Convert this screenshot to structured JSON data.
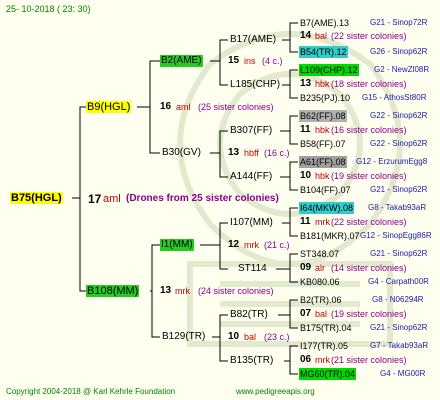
{
  "header": {
    "date": "25- 10-2018 ( 23: 30)"
  },
  "footer": {
    "copyright": "Copyright 2004-2018 @ Karl Kehrle Foundation",
    "site": "www.pedigreeapis.org"
  },
  "root": {
    "name": "B75(HGL)",
    "num": "17",
    "race": "aml",
    "note": "(Drones from 25 sister colonies)"
  },
  "gen1": {
    "top": {
      "name": "B9(HGL)",
      "num": "16",
      "race": "aml",
      "note": "(25 sister colonies)"
    },
    "bottom": {
      "name": "B108(MM)",
      "num": "13",
      "race": "mrk",
      "note": "(24 sister colonies)"
    }
  },
  "gen2": {
    "a": {
      "name": "B2(AME)",
      "num": "15",
      "race": "ins",
      "note": "(4 c.)"
    },
    "b": {
      "name": "B30(GV)",
      "num": "13",
      "race": "hbff",
      "note": "(16 c.)"
    },
    "c": {
      "name": "I1(MM)",
      "num": "12",
      "race": "mrk",
      "note": "(21 c.)"
    },
    "d": {
      "name": "B129(TR)",
      "num": "10",
      "race": "bal",
      "note": "(23 c.)"
    }
  },
  "gen3": [
    {
      "name": "B17(AME)"
    },
    {
      "name": "L185(CHP)"
    },
    {
      "name": "B307(FF)"
    },
    {
      "name": "A144(FF)"
    },
    {
      "name": "I107(MM)"
    },
    {
      "name": "ST114"
    },
    {
      "name": "B82(TR)"
    },
    {
      "name": "B135(TR)"
    }
  ],
  "gen4": [
    {
      "name": "B7(AME).13",
      "code": "G21 - Sinop72R"
    },
    {
      "num": "14",
      "race": "bal",
      "note": "(22 sister colonies)"
    },
    {
      "name": "B54(TR).12",
      "code": "G26 - Sinop62R"
    },
    {
      "name": "L109(CHP).12",
      "code": "G2 - NewZl08R"
    },
    {
      "num": "13",
      "race": "hbk",
      "note": "(18 sister colonies)"
    },
    {
      "name": "B235(PJ).10",
      "code": "G15 - AthosSt80R"
    },
    {
      "name": "B62(FF).08",
      "code": "G22 - Sinop62R"
    },
    {
      "num": "11",
      "race": "hbk",
      "note": "(16 sister colonies)"
    },
    {
      "name": "B58(FF).07",
      "code": "G22 - Sinop62R"
    },
    {
      "name": "A61(FF).08",
      "code": "G12 - ErzurumEgg8"
    },
    {
      "num": "10",
      "race": "hbk",
      "note": "(19 sister colonies)"
    },
    {
      "name": "B104(FF).07",
      "code": "G21 - Sinop62R"
    },
    {
      "name": "I64(MKW).08",
      "code": "G8 - Takab93aR"
    },
    {
      "num": "11",
      "race": "mrk",
      "note": "(22 sister colonies)"
    },
    {
      "name": "B181(MKR).07",
      "code": "G12 - SinopEgg86R"
    },
    {
      "name": "ST348.07",
      "code": "G21 - Sinop62R"
    },
    {
      "num": "09",
      "race": "alr",
      "note": "(14 sister colonies)"
    },
    {
      "name": "KB080.06",
      "code": "G4 - Carpath00R"
    },
    {
      "name": "B2(TR).06",
      "code": "G8 - N06294R"
    },
    {
      "num": "07",
      "race": "bal",
      "note": "(19 sister colonies)"
    },
    {
      "name": "B175(TR).04",
      "code": "G21 - Sinop62R"
    },
    {
      "name": "I177(TR).05",
      "code": "G7 - Takab93aR"
    },
    {
      "num": "06",
      "race": "mrk",
      "note": "(21 sister colonies)"
    },
    {
      "name": "MG60(TR).04",
      "code": "G4 - MG00R"
    }
  ],
  "colors": {
    "background": "#fffff0",
    "highlight_yellow": "#ffff00",
    "highlight_green": "#22cc22",
    "highlight_cyan": "#33cccc",
    "highlight_gray": "#a0a0a0",
    "race": "#c00000",
    "note": "#8b008b",
    "code": "#1a1aa8",
    "footer": "#008000"
  }
}
